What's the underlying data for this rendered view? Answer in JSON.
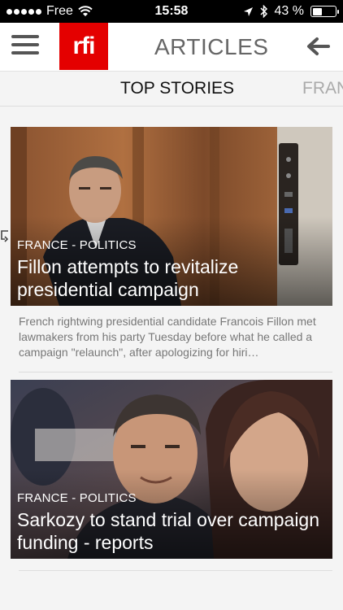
{
  "status_bar": {
    "carrier": "Free",
    "time": "15:58",
    "battery": "43 %",
    "battery_level": 0.43
  },
  "header": {
    "logo_text": "rfi",
    "title": "ARTICLES",
    "menu_icon": "hamburger-menu-icon",
    "back_icon": "arrow-left-icon"
  },
  "tabs": {
    "active": "TOP STORIES",
    "next": "FRAN"
  },
  "articles": [
    {
      "category": "FRANCE - POLITICS",
      "headline": "Fillon attempts to revitalize presidential campaign",
      "summary": "French rightwing presidential candidate Francois Fillon met lawmakers from his party Tuesday before what he called a campaign \"relaunch\", after apologizing for hiri…"
    },
    {
      "category": "FRANCE - POLITICS",
      "headline": "Sarkozy to stand trial over campaign funding - reports",
      "summary": ""
    }
  ]
}
